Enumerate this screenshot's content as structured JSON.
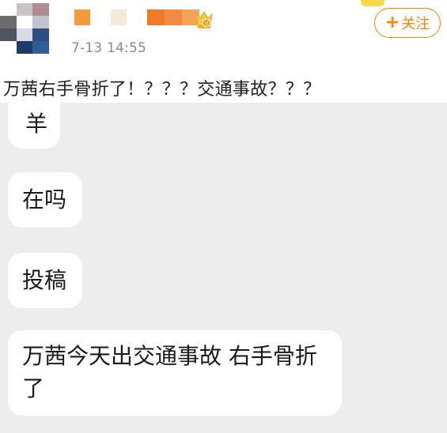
{
  "post": {
    "timestamp": "7-13 14:55",
    "follow_label": "关注",
    "follow_icon": "plus-icon",
    "badge_icon": "vip-crown-icon",
    "text": "万茜右手骨折了！？？？交通事故？？？"
  },
  "chat": {
    "messages": [
      "羊",
      "在吗",
      "投稿",
      "万茜今天出交通事故 右手骨折了"
    ]
  },
  "colors": {
    "accent": "#ff8200",
    "chat_background": "#ededed",
    "bubble": "#ffffff",
    "timestamp": "#8a8a8a"
  }
}
